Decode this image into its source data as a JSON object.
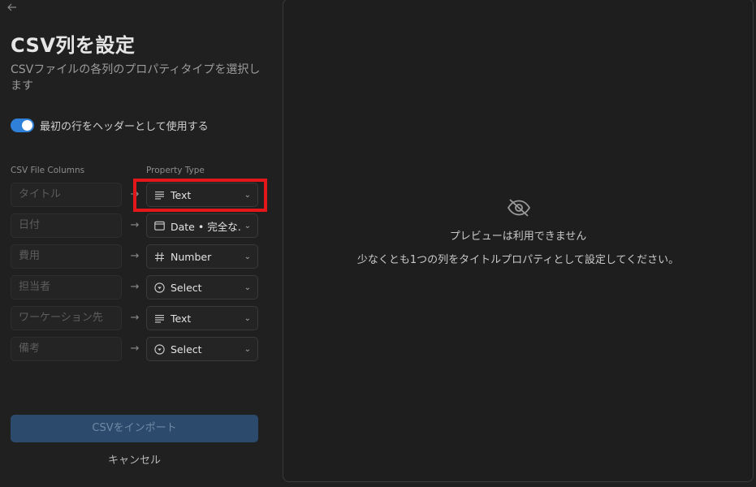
{
  "nav": {
    "back_icon": "arrow-left-icon"
  },
  "header": {
    "title": "CSV列を設定",
    "subtitle": "CSVファイルの各列のプロパティタイプを選択します"
  },
  "options": {
    "use_first_row_as_header_label": "最初の行をヘッダーとして使用する",
    "use_first_row_as_header": true,
    "toggle_color": "#2f80d8"
  },
  "columns_header": {
    "csv": "CSV File Columns",
    "property": "Property Type"
  },
  "rows": [
    {
      "csv_placeholder": "タイトル",
      "type_label": "Text",
      "type_icon": "text-lines-icon"
    },
    {
      "csv_placeholder": "日付",
      "type_label": "Date • 完全な...",
      "type_icon": "calendar-icon"
    },
    {
      "csv_placeholder": "費用",
      "type_label": "Number",
      "type_icon": "hash-icon"
    },
    {
      "csv_placeholder": "担当者",
      "type_label": "Select",
      "type_icon": "select-circle-icon"
    },
    {
      "csv_placeholder": "ワーケーション先",
      "type_label": "Text",
      "type_icon": "text-lines-icon"
    },
    {
      "csv_placeholder": "備考",
      "type_label": "Select",
      "type_icon": "select-circle-icon"
    }
  ],
  "arrow_glyph": "→",
  "chevron_glyph": "⌄",
  "actions": {
    "import_label": "CSVをインポート",
    "cancel_label": "キャンセル"
  },
  "preview": {
    "icon": "eye-off-icon",
    "title": "プレビューは利用できません",
    "message": "少なくとも1つの列をタイトルプロパティとして設定してください。"
  },
  "highlight_color": "#e3161a"
}
